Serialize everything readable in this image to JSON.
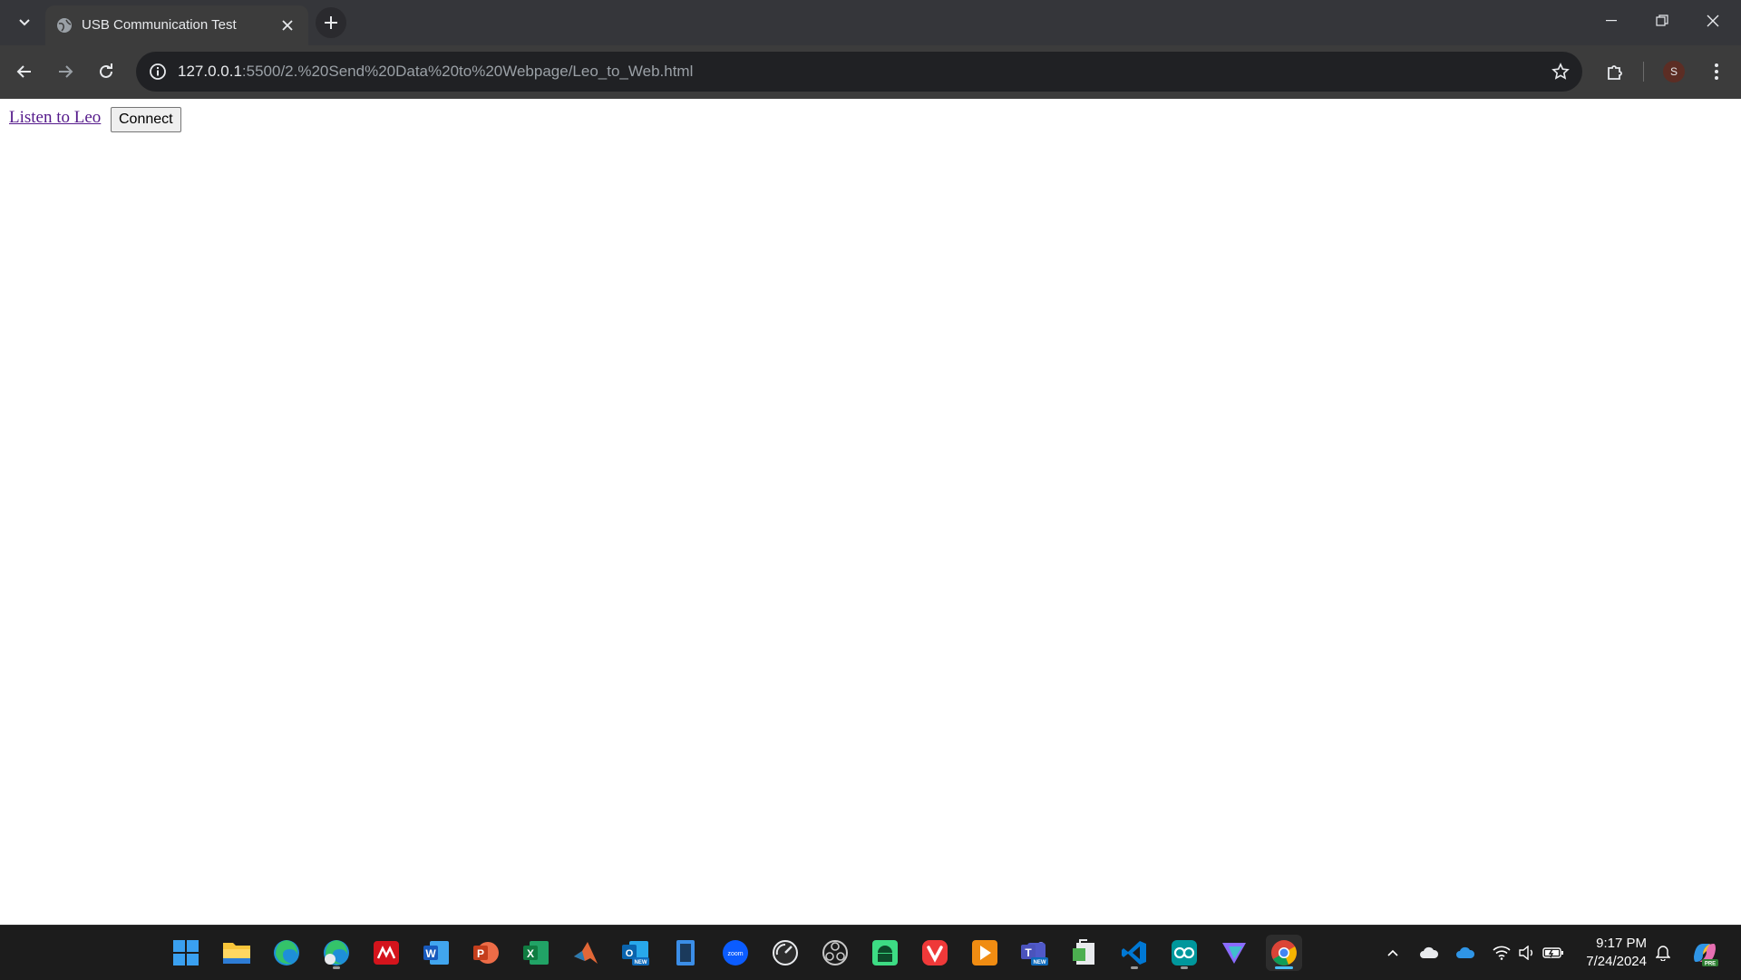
{
  "browser": {
    "tab": {
      "title": "USB Communication Test"
    },
    "address": {
      "host": "127.0.0.1",
      "path": ":5500/2.%20Send%20Data%20to%20Webpage/Leo_to_Web.html"
    },
    "profile_initial": "S"
  },
  "page": {
    "link_text": "Listen to Leo",
    "button_label": "Connect"
  },
  "taskbar": {
    "time": "9:17 PM",
    "date": "7/24/2024",
    "badges": {
      "outlook": "NEW",
      "teams": "NEW",
      "copilot": "PRE"
    },
    "apps": [
      "windows-start",
      "file-explorer",
      "edge",
      "edge-profile",
      "mathworks",
      "word",
      "powerpoint",
      "excel",
      "matlab",
      "outlook",
      "phone-link",
      "zoom",
      "system-monitor",
      "obs",
      "android-studio",
      "vivaldi",
      "video-player",
      "teams",
      "onenote",
      "vscode",
      "arduino",
      "proton-vpn",
      "chrome"
    ]
  }
}
